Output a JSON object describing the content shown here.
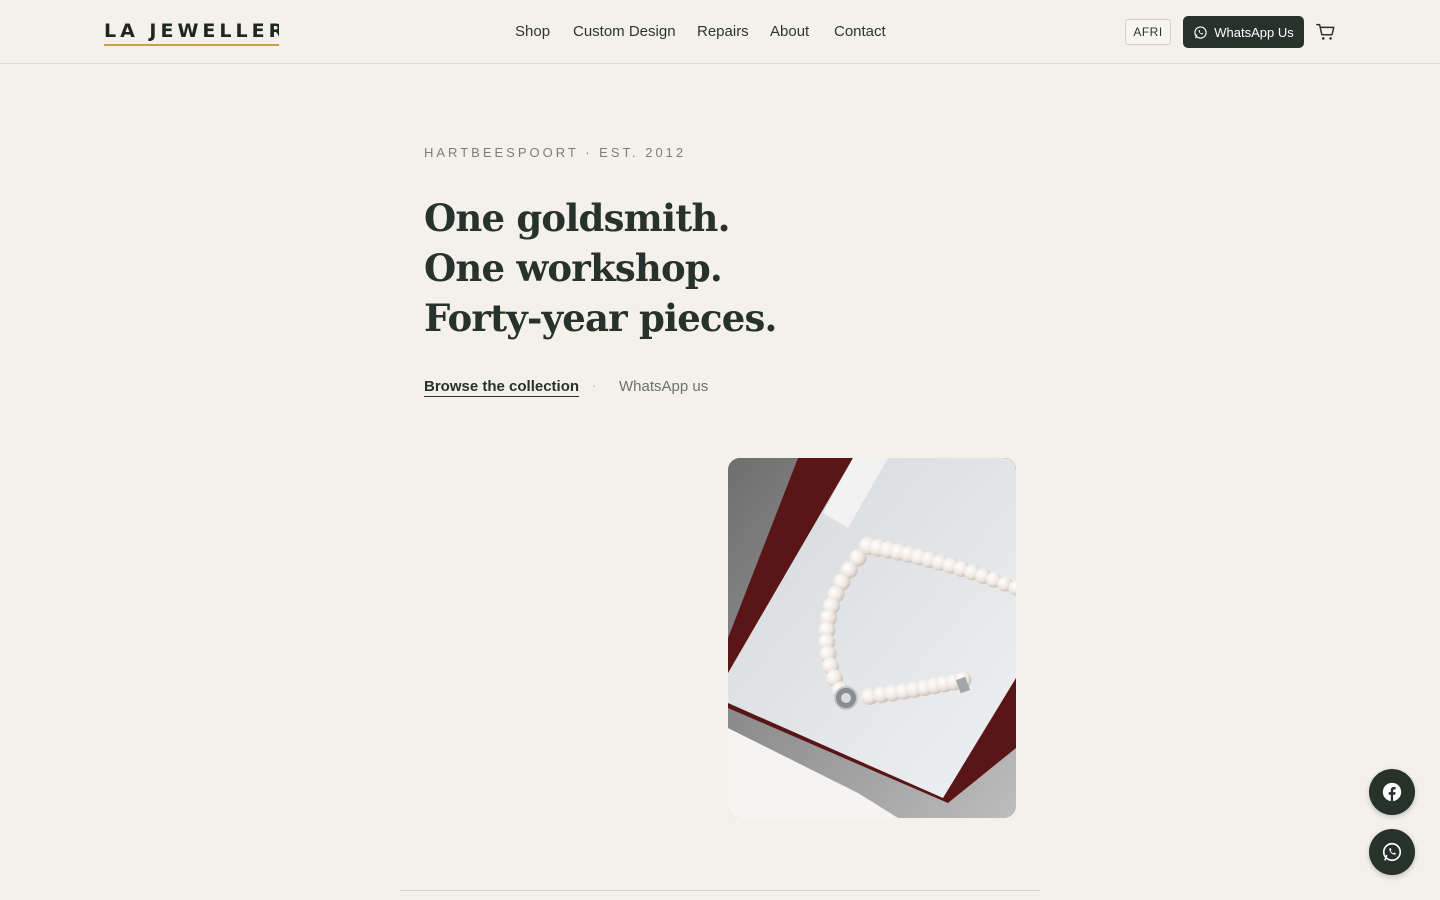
{
  "header": {
    "logo": "LA JEWELLERS",
    "nav": [
      "Shop",
      "Custom Design",
      "Repairs",
      "About",
      "Contact"
    ],
    "language": "AFRI",
    "whatsapp_label": "WhatsApp Us",
    "cart_icon": "cart-icon"
  },
  "hero": {
    "eyebrow": "HARTBEESPOORT · EST. 2012",
    "headline": [
      "One goldsmith.",
      "One workshop.",
      "Forty-year pieces."
    ],
    "cta_primary": "Browse the collection",
    "cta_separator": "·",
    "cta_secondary": "WhatsApp us",
    "image_icon": "pearl-necklace-photo"
  },
  "floating": {
    "facebook_icon": "facebook-icon",
    "whatsapp_icon": "whatsapp-icon"
  },
  "colors": {
    "background": "#f4f1eb",
    "primary": "#26322b",
    "accent": "#c9a04a"
  }
}
